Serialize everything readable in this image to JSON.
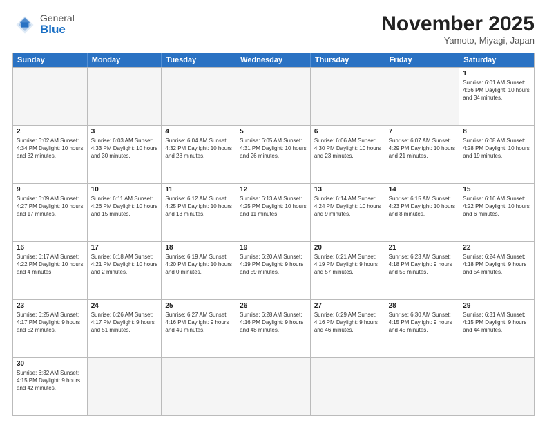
{
  "header": {
    "logo_general": "General",
    "logo_blue": "Blue",
    "month_title": "November 2025",
    "subtitle": "Yamoto, Miyagi, Japan"
  },
  "weekdays": [
    "Sunday",
    "Monday",
    "Tuesday",
    "Wednesday",
    "Thursday",
    "Friday",
    "Saturday"
  ],
  "rows": [
    [
      {
        "day": "",
        "info": ""
      },
      {
        "day": "",
        "info": ""
      },
      {
        "day": "",
        "info": ""
      },
      {
        "day": "",
        "info": ""
      },
      {
        "day": "",
        "info": ""
      },
      {
        "day": "",
        "info": ""
      },
      {
        "day": "1",
        "info": "Sunrise: 6:01 AM\nSunset: 4:36 PM\nDaylight: 10 hours\nand 34 minutes."
      }
    ],
    [
      {
        "day": "2",
        "info": "Sunrise: 6:02 AM\nSunset: 4:34 PM\nDaylight: 10 hours\nand 32 minutes."
      },
      {
        "day": "3",
        "info": "Sunrise: 6:03 AM\nSunset: 4:33 PM\nDaylight: 10 hours\nand 30 minutes."
      },
      {
        "day": "4",
        "info": "Sunrise: 6:04 AM\nSunset: 4:32 PM\nDaylight: 10 hours\nand 28 minutes."
      },
      {
        "day": "5",
        "info": "Sunrise: 6:05 AM\nSunset: 4:31 PM\nDaylight: 10 hours\nand 26 minutes."
      },
      {
        "day": "6",
        "info": "Sunrise: 6:06 AM\nSunset: 4:30 PM\nDaylight: 10 hours\nand 23 minutes."
      },
      {
        "day": "7",
        "info": "Sunrise: 6:07 AM\nSunset: 4:29 PM\nDaylight: 10 hours\nand 21 minutes."
      },
      {
        "day": "8",
        "info": "Sunrise: 6:08 AM\nSunset: 4:28 PM\nDaylight: 10 hours\nand 19 minutes."
      }
    ],
    [
      {
        "day": "9",
        "info": "Sunrise: 6:09 AM\nSunset: 4:27 PM\nDaylight: 10 hours\nand 17 minutes."
      },
      {
        "day": "10",
        "info": "Sunrise: 6:11 AM\nSunset: 4:26 PM\nDaylight: 10 hours\nand 15 minutes."
      },
      {
        "day": "11",
        "info": "Sunrise: 6:12 AM\nSunset: 4:25 PM\nDaylight: 10 hours\nand 13 minutes."
      },
      {
        "day": "12",
        "info": "Sunrise: 6:13 AM\nSunset: 4:25 PM\nDaylight: 10 hours\nand 11 minutes."
      },
      {
        "day": "13",
        "info": "Sunrise: 6:14 AM\nSunset: 4:24 PM\nDaylight: 10 hours\nand 9 minutes."
      },
      {
        "day": "14",
        "info": "Sunrise: 6:15 AM\nSunset: 4:23 PM\nDaylight: 10 hours\nand 8 minutes."
      },
      {
        "day": "15",
        "info": "Sunrise: 6:16 AM\nSunset: 4:22 PM\nDaylight: 10 hours\nand 6 minutes."
      }
    ],
    [
      {
        "day": "16",
        "info": "Sunrise: 6:17 AM\nSunset: 4:22 PM\nDaylight: 10 hours\nand 4 minutes."
      },
      {
        "day": "17",
        "info": "Sunrise: 6:18 AM\nSunset: 4:21 PM\nDaylight: 10 hours\nand 2 minutes."
      },
      {
        "day": "18",
        "info": "Sunrise: 6:19 AM\nSunset: 4:20 PM\nDaylight: 10 hours\nand 0 minutes."
      },
      {
        "day": "19",
        "info": "Sunrise: 6:20 AM\nSunset: 4:19 PM\nDaylight: 9 hours\nand 59 minutes."
      },
      {
        "day": "20",
        "info": "Sunrise: 6:21 AM\nSunset: 4:19 PM\nDaylight: 9 hours\nand 57 minutes."
      },
      {
        "day": "21",
        "info": "Sunrise: 6:23 AM\nSunset: 4:18 PM\nDaylight: 9 hours\nand 55 minutes."
      },
      {
        "day": "22",
        "info": "Sunrise: 6:24 AM\nSunset: 4:18 PM\nDaylight: 9 hours\nand 54 minutes."
      }
    ],
    [
      {
        "day": "23",
        "info": "Sunrise: 6:25 AM\nSunset: 4:17 PM\nDaylight: 9 hours\nand 52 minutes."
      },
      {
        "day": "24",
        "info": "Sunrise: 6:26 AM\nSunset: 4:17 PM\nDaylight: 9 hours\nand 51 minutes."
      },
      {
        "day": "25",
        "info": "Sunrise: 6:27 AM\nSunset: 4:16 PM\nDaylight: 9 hours\nand 49 minutes."
      },
      {
        "day": "26",
        "info": "Sunrise: 6:28 AM\nSunset: 4:16 PM\nDaylight: 9 hours\nand 48 minutes."
      },
      {
        "day": "27",
        "info": "Sunrise: 6:29 AM\nSunset: 4:16 PM\nDaylight: 9 hours\nand 46 minutes."
      },
      {
        "day": "28",
        "info": "Sunrise: 6:30 AM\nSunset: 4:15 PM\nDaylight: 9 hours\nand 45 minutes."
      },
      {
        "day": "29",
        "info": "Sunrise: 6:31 AM\nSunset: 4:15 PM\nDaylight: 9 hours\nand 44 minutes."
      }
    ],
    [
      {
        "day": "30",
        "info": "Sunrise: 6:32 AM\nSunset: 4:15 PM\nDaylight: 9 hours\nand 42 minutes."
      },
      {
        "day": "",
        "info": ""
      },
      {
        "day": "",
        "info": ""
      },
      {
        "day": "",
        "info": ""
      },
      {
        "day": "",
        "info": ""
      },
      {
        "day": "",
        "info": ""
      },
      {
        "day": "",
        "info": ""
      }
    ]
  ]
}
